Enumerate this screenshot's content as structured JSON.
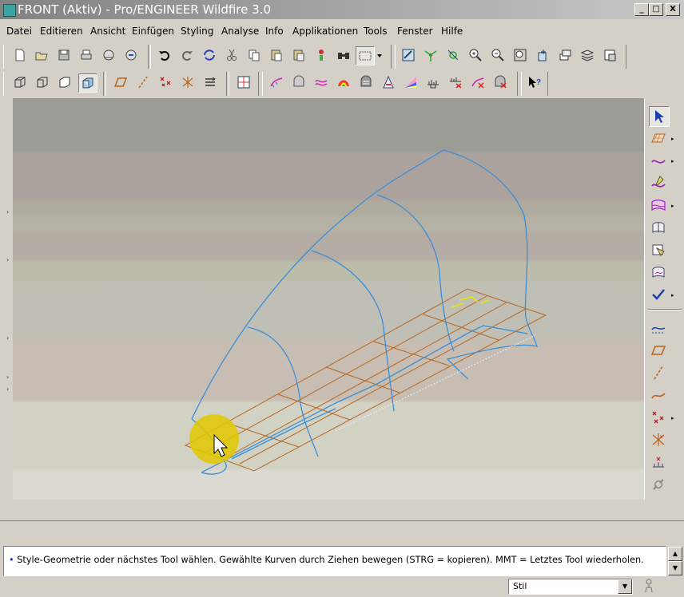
{
  "window": {
    "title": "FRONT (Aktiv) - Pro/ENGINEER Wildfire 3.0",
    "minimize_label": "_",
    "maximize_label": "□",
    "close_label": "X"
  },
  "menu": {
    "items": [
      "Datei",
      "Editieren",
      "Ansicht",
      "Einfügen",
      "Styling",
      "Analyse",
      "Info",
      "Applikationen",
      "Tools",
      "Fenster",
      "Hilfe"
    ]
  },
  "icons": {
    "toolbar1": [
      "new-file-icon",
      "open-file-icon",
      "save-icon",
      "print-icon",
      "mail-icon",
      "mail-attach-icon",
      "undo-icon",
      "redo-icon",
      "regenerate-icon",
      "cut-icon",
      "copy-icon",
      "paste-icon",
      "paste-special-icon",
      "model-tree-icon",
      "find-icon",
      "select-box-icon",
      "repaint-icon",
      "spin-center-icon",
      "orient-icon",
      "zoom-in-icon",
      "zoom-out-icon",
      "refit-icon",
      "named-views-icon",
      "layers-icon",
      "view-manager-icon",
      "tree-icon"
    ],
    "toolbar2": [
      "display-wireframe-icon",
      "display-hidden-icon",
      "display-no-hidden-icon",
      "display-shaded-icon",
      "datum-plane-display-icon",
      "datum-axis-display-icon",
      "point-display-icon",
      "csys-display-icon",
      "spin-center-display-icon",
      "grid-icon",
      "curvature-analysis-icon",
      "section-analysis-icon",
      "offset-analysis-icon",
      "gaussian-analysis-icon",
      "reflection-analysis-icon",
      "draft-analysis-icon",
      "slope-analysis-icon",
      "dihedral-analysis-icon",
      "curve-analysis-icon",
      "delete-analysis-icon",
      "hide-analysis-icon",
      "context-help-icon"
    ],
    "right_toolbar": [
      "select-arrow-icon",
      "active-plane-icon",
      "curve-icon",
      "curve-edit-icon",
      "surface-icon",
      "connect-surface-icon",
      "trim-surface-icon",
      "curve-on-surface-icon",
      "done-check-icon",
      "curve-analysis-icon",
      "datum-plane-icon",
      "datum-axis-icon",
      "sketched-curve-icon",
      "datum-point-icon",
      "csys-icon",
      "offset-point-icon",
      "link-icon"
    ]
  },
  "status": {
    "bullet": "•",
    "message": "Style-Geometrie oder nächstes Tool wählen. Gewählte Kurven durch Ziehen bewegen (STRG = kopieren). MMT = Letztes Tool wiederholen."
  },
  "filter": {
    "selected": "Stil"
  },
  "colors": {
    "curve": "#3a8fd8",
    "plane_grid": "#b8661e",
    "highlight": "#e3c800",
    "active_marker": "#e8e800"
  }
}
